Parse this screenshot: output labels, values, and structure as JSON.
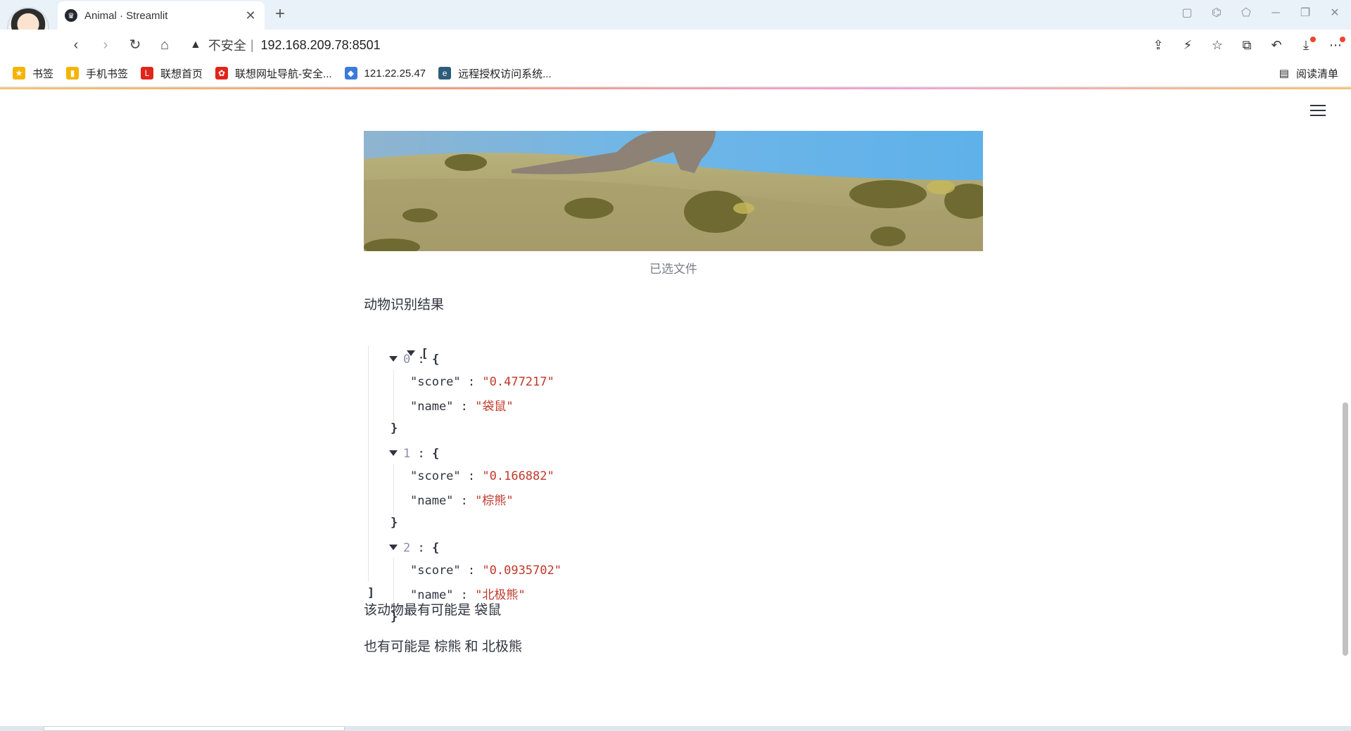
{
  "browser": {
    "tab": {
      "title": "Animal · Streamlit",
      "close": "✕",
      "new_tab": "+"
    },
    "address": {
      "warning": "▲",
      "insecure_label": "不安全",
      "separator": "|",
      "url": "192.168.209.78:8501"
    },
    "bookmarks": [
      {
        "label": "书签",
        "icon": "star-icon",
        "color": "#f5b400",
        "glyph": "★"
      },
      {
        "label": "手机书签",
        "icon": "phone-icon",
        "color": "#f5b400",
        "glyph": "▮"
      },
      {
        "label": "联想首页",
        "icon": "lenovo-icon",
        "color": "#e1251b",
        "glyph": "L"
      },
      {
        "label": "联想网址导航-安全...",
        "icon": "lenovo-nav-icon",
        "color": "#e1251b",
        "glyph": "✿"
      },
      {
        "label": "121.22.25.47",
        "icon": "cube-icon",
        "color": "#3b7bd9",
        "glyph": "◆"
      },
      {
        "label": "远程授权访问系统...",
        "icon": "edge-icon",
        "color": "#2d5b7a",
        "glyph": "e"
      }
    ],
    "reading_list": "阅读清单"
  },
  "app": {
    "image_caption": "已选文件",
    "result_label": "动物识别结果",
    "results": [
      {
        "index": "0",
        "score": "0.477217",
        "name": "袋鼠"
      },
      {
        "index": "1",
        "score": "0.166882",
        "name": "棕熊"
      },
      {
        "index": "2",
        "score": "0.0935702",
        "name": "北极熊"
      }
    ],
    "most_likely_text": "该动物最有可能是 袋鼠",
    "also_possible_text": "也有可能是 棕熊 和 北极熊"
  },
  "colors": {
    "json_string": "#c0392b",
    "json_index": "#8a8fa8",
    "text": "#31333f",
    "caption": "#7b7e87"
  }
}
